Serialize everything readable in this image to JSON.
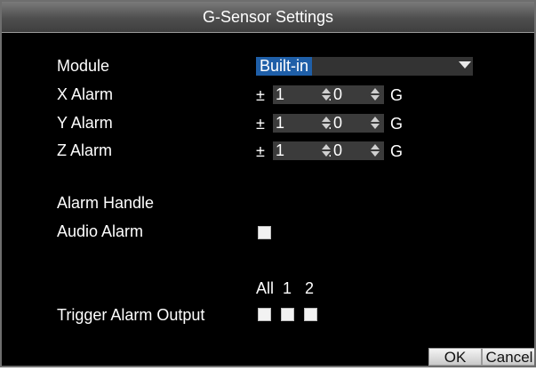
{
  "window": {
    "title": "G-Sensor Settings"
  },
  "module": {
    "label": "Module",
    "value": "Built-in"
  },
  "alarms": [
    {
      "label": "X Alarm",
      "sign": "±",
      "int": "1",
      "frac": "0",
      "decimal": ".",
      "unit": "G"
    },
    {
      "label": "Y Alarm",
      "sign": "±",
      "int": "1",
      "frac": "0",
      "decimal": ".",
      "unit": "G"
    },
    {
      "label": "Z Alarm",
      "sign": "±",
      "int": "1",
      "frac": "0",
      "decimal": ".",
      "unit": "G"
    }
  ],
  "alarm_handle": {
    "label": "Alarm Handle"
  },
  "audio_alarm": {
    "label": "Audio Alarm",
    "checked": false
  },
  "trigger": {
    "label": "Trigger Alarm Output",
    "columns": [
      "All",
      "1",
      "2"
    ],
    "checked": [
      false,
      false,
      false
    ]
  },
  "buttons": {
    "ok": "OK",
    "cancel": "Cancel"
  }
}
